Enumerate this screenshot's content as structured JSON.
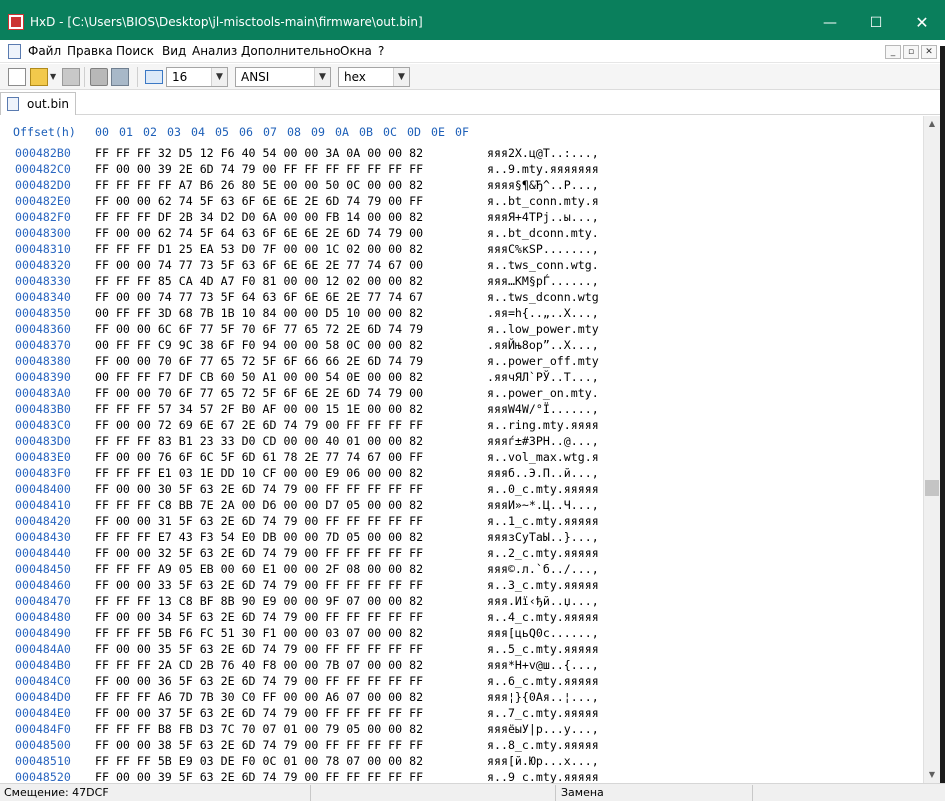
{
  "window": {
    "app": "HxD",
    "title": "HxD - [C:\\Users\\BIOS\\Desktop\\jl-misctools-main\\firmware\\out.bin]",
    "controls": {
      "minimize": "—",
      "maximize": "☐",
      "close": "✕"
    }
  },
  "menu": {
    "items": [
      "Файл",
      "Правка",
      "Поиск",
      "Вид",
      "Анализ",
      "Дополнительно",
      "Окна",
      "?"
    ],
    "mdi_controls": [
      "_",
      "▫",
      "✕"
    ]
  },
  "toolbar": {
    "bytes_per_row": "16",
    "charset": "ANSI",
    "offset_base": "hex",
    "icons": [
      "new-file-icon",
      "open-file-icon",
      "save-icon",
      "open-disk-icon",
      "open-ram-icon",
      "columns-icon"
    ]
  },
  "tab": {
    "label": "out.bin"
  },
  "hex_view": {
    "header": {
      "offset_label": "Offset(h)",
      "columns": [
        "00",
        "01",
        "02",
        "03",
        "04",
        "05",
        "06",
        "07",
        "08",
        "09",
        "0A",
        "0B",
        "0C",
        "0D",
        "0E",
        "0F"
      ]
    },
    "rows": [
      {
        "offset": "000482B0",
        "hex": "FF FF FF 32 D5 12 F6 40 54 00 00 3A 0A 00 00 82",
        "text": "яяя2Х.ц@T..:...‚"
      },
      {
        "offset": "000482C0",
        "hex": "FF 00 00 39 2E 6D 74 79 00 FF FF FF FF FF FF FF",
        "text": "я..9.mty.яяяяяяя"
      },
      {
        "offset": "000482D0",
        "hex": "FF FF FF FF A7 B6 26 80 5E 00 00 50 0C 00 00 82",
        "text": "яяяя§¶&Ђ^..P...‚"
      },
      {
        "offset": "000482E0",
        "hex": "FF 00 00 62 74 5F 63 6F 6E 6E 2E 6D 74 79 00 FF",
        "text": "я..bt_conn.mty.я"
      },
      {
        "offset": "000482F0",
        "hex": "FF FF FF DF 2B 34 D2 D0 6A 00 00 FB 14 00 00 82",
        "text": "яяяЯ+4ТРj..ы...‚"
      },
      {
        "offset": "00048300",
        "hex": "FF 00 00 62 74 5F 64 63 6F 6E 6E 2E 6D 74 79 00",
        "text": "я..bt_dconn.mty."
      },
      {
        "offset": "00048310",
        "hex": "FF FF FF D1 25 EA 53 D0 7F 00 00 1C 02 00 00 82",
        "text": "яяяС%кSР.......‚"
      },
      {
        "offset": "00048320",
        "hex": "FF 00 00 74 77 73 5F 63 6F 6E 6E 2E 77 74 67 00",
        "text": "я..tws_conn.wtg."
      },
      {
        "offset": "00048330",
        "hex": "FF FF FF 85 CA 4D A7 F0 81 00 00 12 02 00 00 82",
        "text": "яяя…КМ§рЃ......‚"
      },
      {
        "offset": "00048340",
        "hex": "FF 00 00 74 77 73 5F 64 63 6F 6E 6E 2E 77 74 67",
        "text": "я..tws_dconn.wtg"
      },
      {
        "offset": "00048350",
        "hex": "00 FF FF 3D 68 7B 1B 10 84 00 00 D5 10 00 00 82",
        "text": ".яя=h{..„..Х...‚"
      },
      {
        "offset": "00048360",
        "hex": "FF 00 00 6C 6F 77 5F 70 6F 77 65 72 2E 6D 74 79",
        "text": "я..low_power.mty"
      },
      {
        "offset": "00048370",
        "hex": "00 FF FF C9 9C 38 6F F0 94 00 00 58 0C 00 00 82",
        "text": ".яяЙњ8oр”..X...‚"
      },
      {
        "offset": "00048380",
        "hex": "FF 00 00 70 6F 77 65 72 5F 6F 66 66 2E 6D 74 79",
        "text": "я..power_off.mty"
      },
      {
        "offset": "00048390",
        "hex": "00 FF FF F7 DF CB 60 50 A1 00 00 54 0E 00 00 82",
        "text": ".яячЯЛ`PЎ..T...‚"
      },
      {
        "offset": "000483A0",
        "hex": "FF 00 00 70 6F 77 65 72 5F 6F 6E 2E 6D 74 79 00",
        "text": "я..power_on.mty."
      },
      {
        "offset": "000483B0",
        "hex": "FF FF FF 57 34 57 2F B0 AF 00 00 15 1E 00 00 82",
        "text": "яяяW4W/°Ї......‚"
      },
      {
        "offset": "000483C0",
        "hex": "FF 00 00 72 69 6E 67 2E 6D 74 79 00 FF FF FF FF",
        "text": "я..ring.mty.яяяя"
      },
      {
        "offset": "000483D0",
        "hex": "FF FF FF 83 B1 23 33 D0 CD 00 00 40 01 00 00 82",
        "text": "яяяѓ±#3РН..@...‚"
      },
      {
        "offset": "000483E0",
        "hex": "FF 00 00 76 6F 6C 5F 6D 61 78 2E 77 74 67 00 FF",
        "text": "я..vol_max.wtg.я"
      },
      {
        "offset": "000483F0",
        "hex": "FF FF FF E1 03 1E DD 10 CF 00 00 E9 06 00 00 82",
        "text": "яяяб..Э.П..й...‚"
      },
      {
        "offset": "00048400",
        "hex": "FF 00 00 30 5F 63 2E 6D 74 79 00 FF FF FF FF FF",
        "text": "я..0_c.mty.яяяяя"
      },
      {
        "offset": "00048410",
        "hex": "FF FF FF C8 BB 7E 2A 00 D6 00 00 D7 05 00 00 82",
        "text": "яяяИ»~*.Ц..Ч...‚"
      },
      {
        "offset": "00048420",
        "hex": "FF 00 00 31 5F 63 2E 6D 74 79 00 FF FF FF FF FF",
        "text": "я..1_c.mty.яяяяя"
      },
      {
        "offset": "00048430",
        "hex": "FF FF FF E7 43 F3 54 E0 DB 00 00 7D 05 00 00 82",
        "text": "яяязCуTаЫ..}...‚"
      },
      {
        "offset": "00048440",
        "hex": "FF 00 00 32 5F 63 2E 6D 74 79 00 FF FF FF FF FF",
        "text": "я..2_c.mty.яяяяя"
      },
      {
        "offset": "00048450",
        "hex": "FF FF FF A9 05 EB 00 60 E1 00 00 2F 08 00 00 82",
        "text": "яяя©.л.`б../...‚"
      },
      {
        "offset": "00048460",
        "hex": "FF 00 00 33 5F 63 2E 6D 74 79 00 FF FF FF FF FF",
        "text": "я..3_c.mty.яяяяя"
      },
      {
        "offset": "00048470",
        "hex": "FF FF FF 13 C8 BF 8B 90 E9 00 00 9F 07 00 00 82",
        "text": "яяя.Иї‹ђй..џ...‚"
      },
      {
        "offset": "00048480",
        "hex": "FF 00 00 34 5F 63 2E 6D 74 79 00 FF FF FF FF FF",
        "text": "я..4_c.mty.яяяяя"
      },
      {
        "offset": "00048490",
        "hex": "FF FF FF 5B F6 FC 51 30 F1 00 00 03 07 00 00 82",
        "text": "яяя[цьQ0с......‚"
      },
      {
        "offset": "000484A0",
        "hex": "FF 00 00 35 5F 63 2E 6D 74 79 00 FF FF FF FF FF",
        "text": "я..5_c.mty.яяяяя"
      },
      {
        "offset": "000484B0",
        "hex": "FF FF FF 2A CD 2B 76 40 F8 00 00 7B 07 00 00 82",
        "text": "яяя*Н+v@ш..{...‚"
      },
      {
        "offset": "000484C0",
        "hex": "FF 00 00 36 5F 63 2E 6D 74 79 00 FF FF FF FF FF",
        "text": "я..6_c.mty.яяяяя"
      },
      {
        "offset": "000484D0",
        "hex": "FF FF FF A6 7D 7B 30 C0 FF 00 00 A6 07 00 00 82",
        "text": "яяя¦}{0Ая..¦...‚"
      },
      {
        "offset": "000484E0",
        "hex": "FF 00 00 37 5F 63 2E 6D 74 79 00 FF FF FF FF FF",
        "text": "я..7_c.mty.яяяяя"
      },
      {
        "offset": "000484F0",
        "hex": "FF FF FF B8 FB D3 7C 70 07 01 00 79 05 00 00 82",
        "text": "яяяёыУ|p...y...‚"
      },
      {
        "offset": "00048500",
        "hex": "FF 00 00 38 5F 63 2E 6D 74 79 00 FF FF FF FF FF",
        "text": "я..8_c.mty.яяяяя"
      },
      {
        "offset": "00048510",
        "hex": "FF FF FF 5B E9 03 DE F0 0C 01 00 78 07 00 00 82",
        "text": "яяя[й.Юр...x...‚"
      },
      {
        "offset": "00048520",
        "hex": "FF 00 00 39 5F 63 2E 6D 74 79 00 FF FF FF FF FF",
        "text": "я..9_c.mty.яяяяя"
      }
    ]
  },
  "status": {
    "offset": "Смещение: 47DCF",
    "mode": "Замена"
  },
  "colors": {
    "titlebar": "#0a7f5c",
    "offset_text": "#2a66c0"
  }
}
